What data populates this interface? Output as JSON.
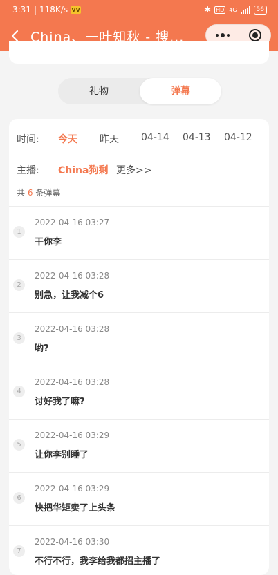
{
  "status_bar": {
    "time": "3:31",
    "speed": "118K/s",
    "badge": "VV",
    "network": "4G",
    "hd": "HD",
    "battery": "56"
  },
  "nav": {
    "title": "China、一叶知秋 - 搜..."
  },
  "tabs": [
    {
      "label": "礼物",
      "active": false
    },
    {
      "label": "弹幕",
      "active": true
    }
  ],
  "filter": {
    "time_label": "时间:",
    "dates": [
      "今天",
      "昨天",
      "04-14",
      "04-13",
      "04-12"
    ],
    "active_date": "今天",
    "host_label": "主播:",
    "host_name": "China狗剩",
    "more": "更多>>"
  },
  "count": {
    "prefix": "共",
    "value": "6",
    "suffix": "条弹幕"
  },
  "messages": [
    {
      "index": "1",
      "time": "2022-04-16 03:27",
      "text": "干你李"
    },
    {
      "index": "2",
      "time": "2022-04-16 03:28",
      "text": "别急，让我减个6"
    },
    {
      "index": "3",
      "time": "2022-04-16 03:28",
      "text": "哟?"
    },
    {
      "index": "4",
      "time": "2022-04-16 03:28",
      "text": "讨好我了嘛?"
    },
    {
      "index": "5",
      "time": "2022-04-16 03:29",
      "text": "让你李别睡了"
    },
    {
      "index": "6",
      "time": "2022-04-16 03:29",
      "text": "快把华矩卖了上头条"
    },
    {
      "index": "7",
      "time": "2022-04-16 03:30",
      "text": "不行不行，我李给我都招主播了"
    }
  ],
  "colors": {
    "accent": "#f4784f",
    "background": "#f4f4f4"
  }
}
